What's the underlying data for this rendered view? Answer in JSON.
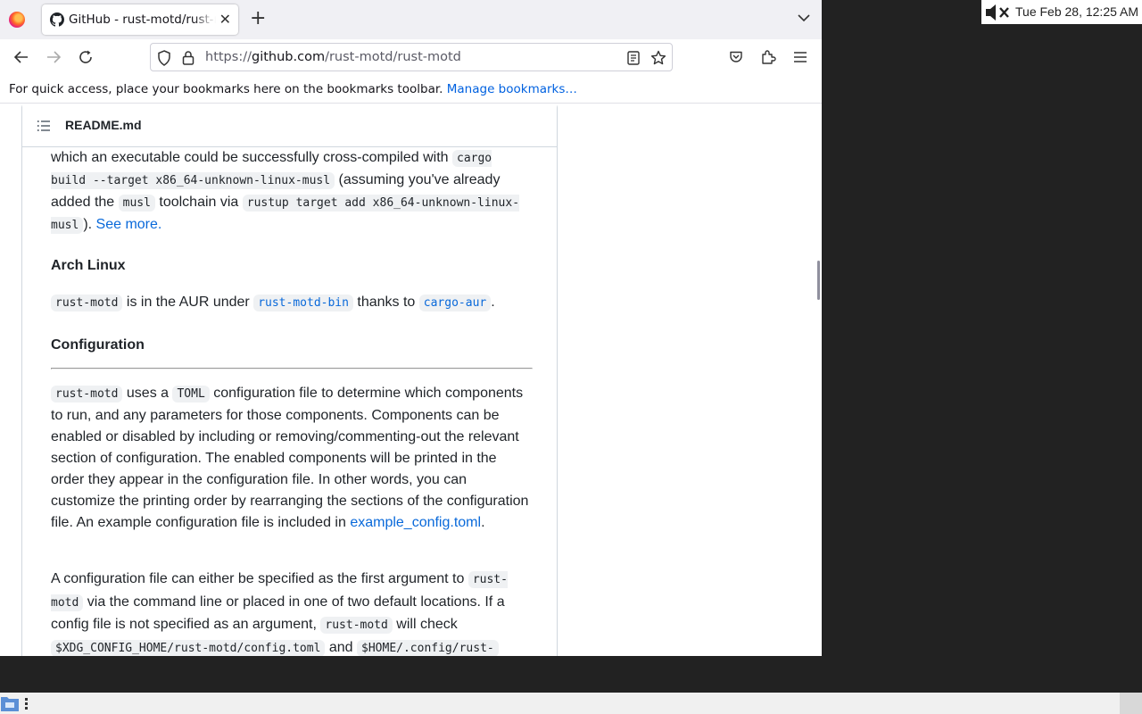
{
  "browser": {
    "tab": {
      "title": "GitHub - rust-motd/rust-motd",
      "close": "✕"
    },
    "new_tab": "+",
    "url": {
      "scheme": "https://",
      "domain": "github.com",
      "path": "/rust-motd/rust-motd"
    },
    "bookmarks_prompt": "For quick access, place your bookmarks here on the bookmarks toolbar.",
    "manage_bookmarks": "Manage bookmarks…"
  },
  "readme": {
    "filename": "README.md",
    "p1": {
      "t1": "which an executable could be successfully cross-compiled with ",
      "c1": "cargo build --target x86_64-unknown-linux-musl",
      "t2": " (assuming you've already added the ",
      "c2": "musl",
      "t3": " toolchain via ",
      "c3": "rustup target add x86_64-unknown-linux-musl",
      "t4": "). ",
      "link": "See more."
    },
    "arch_heading": "Arch Linux",
    "p2": {
      "c1": "rust-motd",
      "t1": " is in the AUR under ",
      "c2": "rust-motd-bin",
      "t2": " thanks to ",
      "c3": "cargo-aur",
      "t3": "."
    },
    "config_heading": "Configuration",
    "p3": {
      "c1": "rust-motd",
      "t1": " uses a ",
      "c2": "TOML",
      "t2": " configuration file to determine which components to run, and any parameters for those components. Components can be enabled or disabled by including or removing/commenting-out the relevant section of configuration. The enabled components will be printed in the order they appear in the configuration file. In other words, you can customize the printing order by rearranging the sections of the configuration file. An example configuration file is included in ",
      "link": "example_config.toml",
      "t3": "."
    },
    "p4": {
      "t1": "A configuration file can either be specified as the first argument to ",
      "c1": "rust-motd",
      "t2": " via the command line or placed in one of two default locations. If a config file is not specified as an argument, ",
      "c2": "rust-motd",
      "t3": " will check ",
      "c3": "$XDG_CONFIG_HOME/rust-motd/config.toml",
      "t4": " and ",
      "c4": "$HOME/.config/rust-"
    }
  },
  "system": {
    "clock": "Tue Feb 28, 12:25 AM",
    "volume_icon": "volume-muted-icon"
  },
  "colors": {
    "link": "#0969da",
    "accent": "#0061e0"
  }
}
